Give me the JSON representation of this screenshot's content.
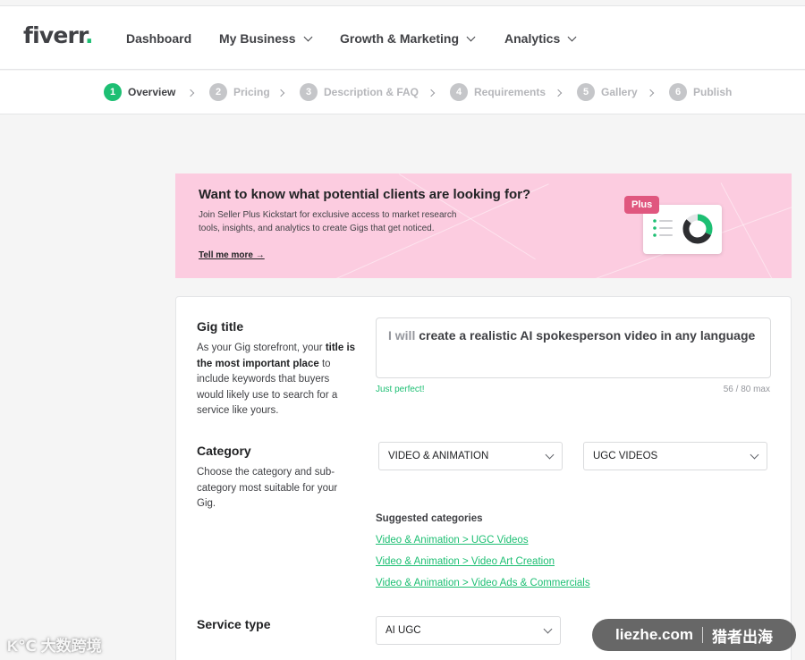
{
  "nav": {
    "logo": "fiverr",
    "logo_dot": ".",
    "items": [
      {
        "label": "Dashboard",
        "dropdown": false
      },
      {
        "label": "My Business",
        "dropdown": true
      },
      {
        "label": "Growth & Marketing",
        "dropdown": true
      },
      {
        "label": "Analytics",
        "dropdown": true
      }
    ]
  },
  "steps": [
    {
      "num": "1",
      "label": "Overview",
      "active": true
    },
    {
      "num": "2",
      "label": "Pricing",
      "active": false
    },
    {
      "num": "3",
      "label": "Description & FAQ",
      "active": false
    },
    {
      "num": "4",
      "label": "Requirements",
      "active": false
    },
    {
      "num": "5",
      "label": "Gallery",
      "active": false
    },
    {
      "num": "6",
      "label": "Publish",
      "active": false
    }
  ],
  "banner": {
    "title": "Want to know what potential clients are looking for?",
    "desc": "Join Seller Plus Kickstart for exclusive access to market research tools, insights, and analytics to create Gigs that get noticed.",
    "link": "Tell me more →",
    "badge": "Plus"
  },
  "gig_title": {
    "label": "Gig title",
    "hint_a": "As your Gig storefront, your ",
    "hint_b": "title is the most important place",
    "hint_c": " to include keywords that buyers would likely use to search for a service like yours.",
    "prefix": "I will",
    "value": " create a realistic AI spokesperson video in any language",
    "status": "Just perfect!",
    "count": "56 / 80 max"
  },
  "category": {
    "label": "Category",
    "hint": "Choose the category and sub-category most suitable for your Gig.",
    "main": "VIDEO & ANIMATION",
    "sub": "UGC VIDEOS",
    "suggested_title": "Suggested categories",
    "suggested": [
      "Video & Animation > UGC Videos",
      "Video & Animation > Video Art Creation",
      "Video & Animation > Video Ads & Commercials"
    ]
  },
  "service_type": {
    "label": "Service type",
    "value": "AI UGC"
  },
  "watermarks": {
    "left": "K℃ 大数跨境",
    "right_a": "liezhe.com",
    "right_b": "猎者出海"
  },
  "colors": {
    "brand_green": "#1dbf73",
    "banner_pink": "#fccce0",
    "plus_badge": "#e0577f"
  }
}
